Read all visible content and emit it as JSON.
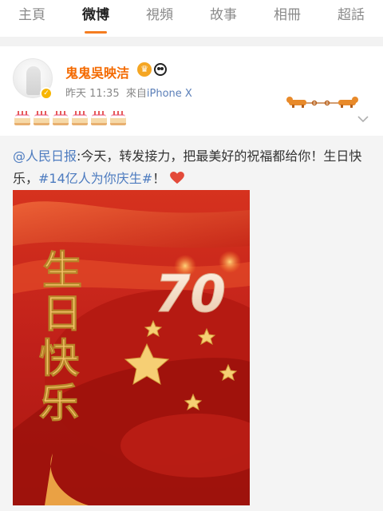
{
  "tabs": [
    "主頁",
    "微博",
    "視頻",
    "故事",
    "相冊",
    "超話"
  ],
  "active_tab": 1,
  "post": {
    "author": "鬼鬼吳映洁",
    "time": "昨天 11:35",
    "source_prefix": "來自",
    "source": "iPhone X",
    "emoji_names": [
      "birthday-cake",
      "birthday-cake",
      "birthday-cake",
      "birthday-cake",
      "birthday-cake",
      "birthday-cake"
    ]
  },
  "forward": {
    "mention": "@人民日报",
    "text": ":今天，转发接力，把最美好的祝福都给你！生日快乐，",
    "hashtag": "#14亿人为你庆生#",
    "suffix": "！",
    "poster_text": "生日快乐",
    "poster_number": "70"
  },
  "colors": {
    "accent": "#f57d20",
    "author": "#f46a00",
    "link": "#4d7bbf",
    "poster_red": "#c5211a",
    "gold": "#f5c36a"
  }
}
